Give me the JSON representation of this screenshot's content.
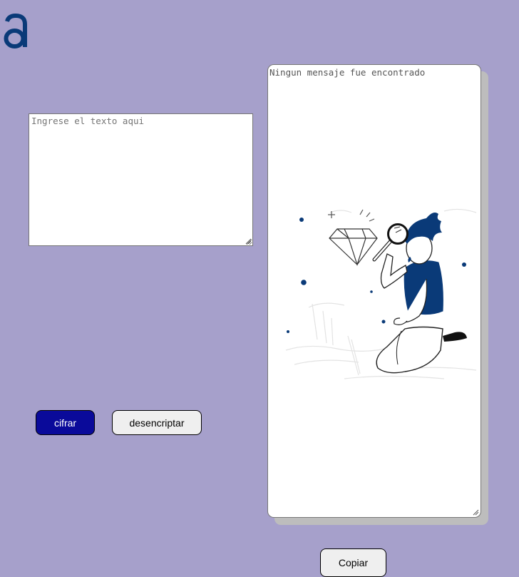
{
  "logo": {
    "icon": "a-letter-logo",
    "color": "#0a3a78"
  },
  "input": {
    "placeholder": "Ingrese el texto aqui",
    "value": ""
  },
  "buttons": {
    "encrypt_label": "cifrar",
    "decrypt_label": "desencriptar",
    "copy_label": "Copiar"
  },
  "output": {
    "message": "Ningun mensaje fue encontrado",
    "illustration": "person-with-magnifying-glass-searching-diamond"
  },
  "colors": {
    "background": "#a6a0cb",
    "primary_button": "#0a0a9a",
    "illustration_accent": "#0a3a78"
  }
}
